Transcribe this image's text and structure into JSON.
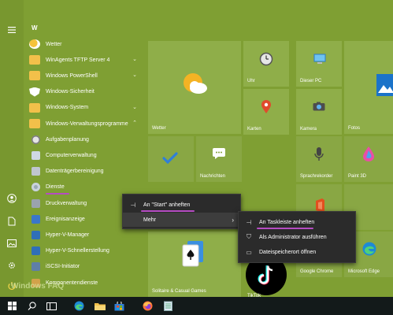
{
  "section_letter": "W",
  "apps": [
    {
      "label": "Wetter",
      "icon": "weather-icon",
      "chevron": false
    },
    {
      "label": "WinAgents TFTP Server 4",
      "icon": "folder-icon",
      "chevron": true
    },
    {
      "label": "Windows PowerShell",
      "icon": "folder-icon",
      "chevron": true
    },
    {
      "label": "Windows-Sicherheit",
      "icon": "shield-icon",
      "chevron": false
    },
    {
      "label": "Windows-System",
      "icon": "folder-icon",
      "chevron": true
    },
    {
      "label": "Windows-Verwaltungsprogramme",
      "icon": "folder-icon",
      "chevron": true
    },
    {
      "label": "Aufgabenplanung",
      "icon": "clock-icon",
      "chevron": false
    },
    {
      "label": "Computerverwaltung",
      "icon": "computer-icon",
      "chevron": false
    },
    {
      "label": "Datenträgerbereinigung",
      "icon": "disk-icon",
      "chevron": false
    },
    {
      "label": "Dienste",
      "icon": "gear-icon",
      "chevron": false
    },
    {
      "label": "Druckverwaltung",
      "icon": "printer-icon",
      "chevron": false
    },
    {
      "label": "Ereignisanzeige",
      "icon": "event-icon",
      "chevron": false
    },
    {
      "label": "Hyper-V-Manager",
      "icon": "hyperv-icon",
      "chevron": false
    },
    {
      "label": "Hyper-V-Schnellerstellung",
      "icon": "hyperv-icon",
      "chevron": false
    },
    {
      "label": "iSCSI-Initiator",
      "icon": "iscsi-icon",
      "chevron": false
    },
    {
      "label": "Komponentendienste",
      "icon": "component-icon",
      "chevron": false
    }
  ],
  "tiles": {
    "wetter": "Wetter",
    "uhr": "Uhr",
    "dieser_pc": "Dieser PC",
    "karten": "Karten",
    "kamera": "Kamera",
    "fotos": "Fotos",
    "nachrichten": "Nachrichten",
    "sprachrekorder": "Sprachrekorder",
    "paint3d": "Paint 3D",
    "solitaire": "Solitaire & Casual Games",
    "tiktok": "TikTok",
    "chrome": "Google Chrome",
    "edge": "Microsoft Edge"
  },
  "context_menu": {
    "pin_start": "An \"Start\" anheften",
    "more": "Mehr"
  },
  "submenu": {
    "pin_taskbar": "An Taskleiste anheften",
    "run_admin": "Als Administrator ausführen",
    "open_location": "Dateispeicherort öffnen"
  },
  "watermark": "Windows FAQ",
  "colors": {
    "accent_underline": "#b54cc2",
    "menu_bg": "#2b2b2b",
    "start_bg": "#7f9f33"
  }
}
